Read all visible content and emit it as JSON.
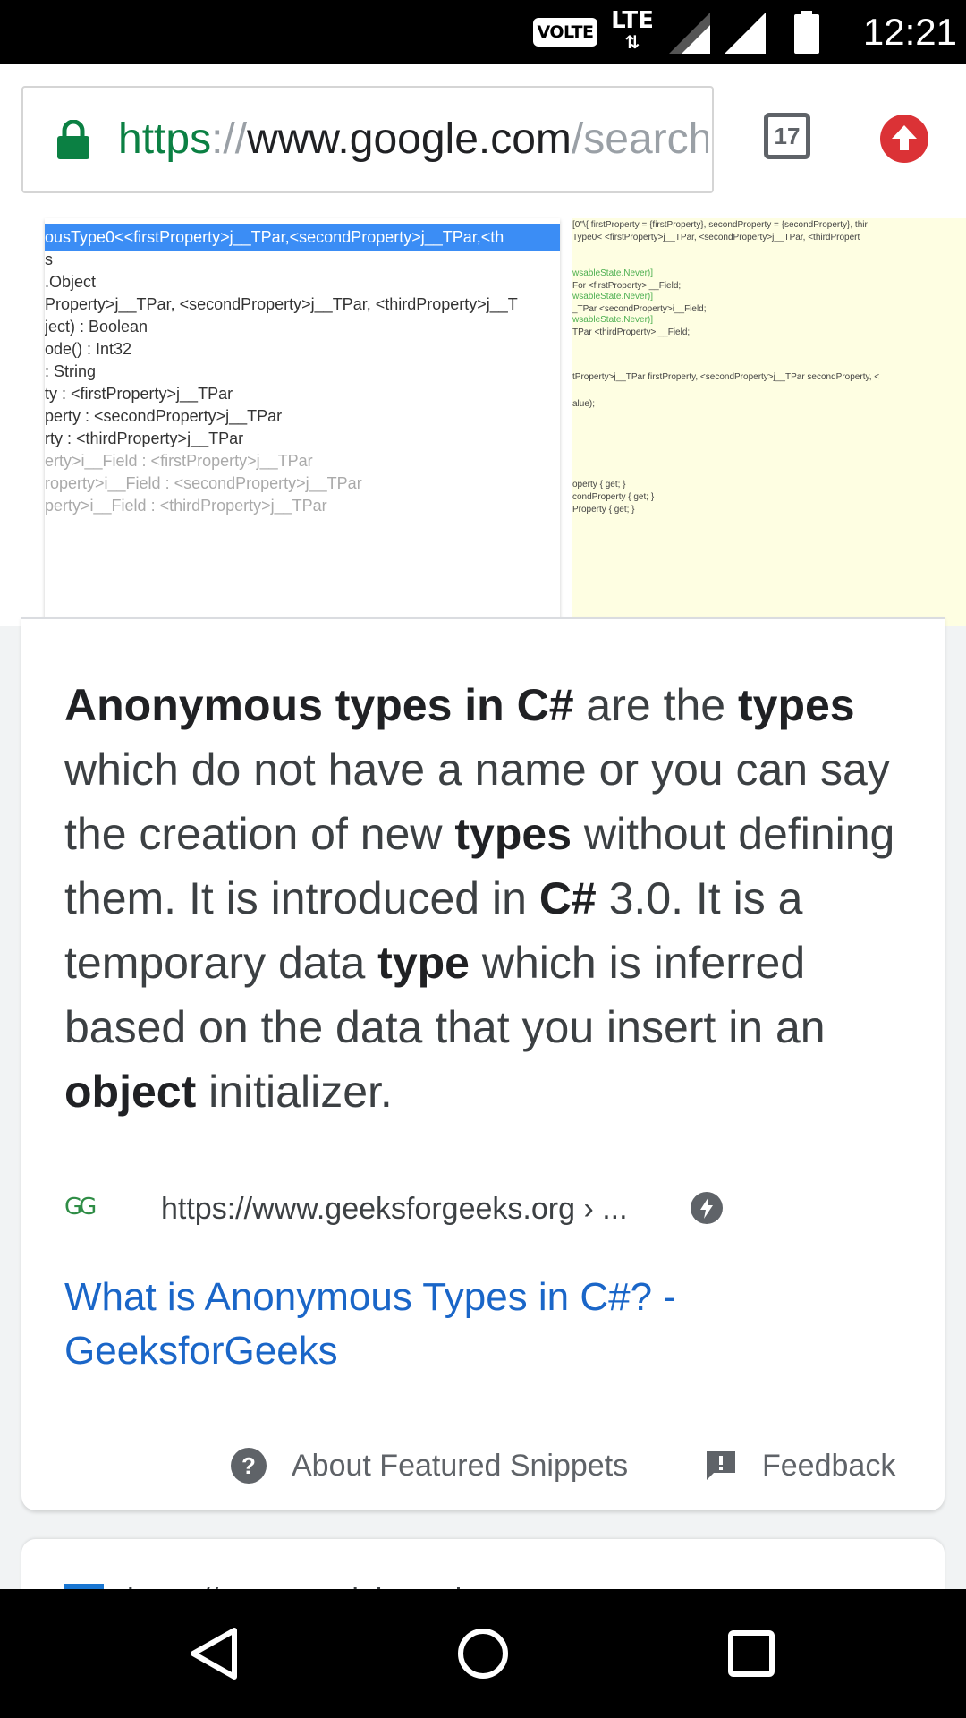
{
  "status_bar": {
    "volte": "VOLTE",
    "lte": "LTE",
    "time": "12:21"
  },
  "toolbar": {
    "url_scheme": "https",
    "url_sep": "://",
    "url_host": "www.google.com",
    "url_path": "/search?q=anonymous+types",
    "tab_count": "17"
  },
  "images": {
    "code_lines": [
      "ousType0<<firstProperty>j__TPar,<secondProperty>j__TPar,<th",
      "s",
      ".Object",
      "Property>j__TPar, <secondProperty>j__TPar, <thirdProperty>j__T",
      "ject) : Boolean",
      "ode() : Int32",
      ": String",
      "ty : <firstProperty>j__TPar",
      "perty : <secondProperty>j__TPar",
      "rty : <thirdProperty>j__TPar",
      "erty>i__Field : <firstProperty>j__TPar",
      "roperty>i__Field : <secondProperty>j__TPar",
      "perty>i__Field : <thirdProperty>j__TPar"
    ],
    "panel2_lines": [
      "[0\"\\{ firstProperty = {firstProperty}, secondProperty = {secondProperty}, thir",
      "Type0< <firstProperty>j__TPar, <secondProperty>j__TPar, <thirdPropert",
      "wsableState.Never)]",
      "For <firstProperty>i__Field;",
      "wsableState.Never)]",
      "_TPar <secondProperty>i__Field;",
      "wsableState.Never)]",
      "TPar <thirdProperty>i__Field;",
      "tProperty>j__TPar firstProperty, <secondProperty>j__TPar secondProperty, <",
      "alue);",
      "operty { get; }",
      "condProperty { get; }",
      "Property { get; }"
    ]
  },
  "card": {
    "snippet": [
      {
        "t": "Anonymous types in C#",
        "b": true
      },
      {
        "t": " are the ",
        "b": false
      },
      {
        "t": "types",
        "b": true
      },
      {
        "t": " which do not have a name or you can say the creation of new ",
        "b": false
      },
      {
        "t": "types",
        "b": true
      },
      {
        "t": " without defining them. It is introduced in ",
        "b": false
      },
      {
        "t": "C#",
        "b": true
      },
      {
        "t": " 3.0. It is a temporary data ",
        "b": false
      },
      {
        "t": "type",
        "b": true
      },
      {
        "t": " which is inferred based on the data that you insert in an ",
        "b": false
      },
      {
        "t": "object",
        "b": true
      },
      {
        "t": " initializer.",
        "b": false
      }
    ],
    "source_icon_text": "GG",
    "source_url": "https://www.geeksforgeeks.org › ...",
    "result_title": "What is Anonymous Types in C#? - GeeksforGeeks",
    "about_label": "About Featured Snippets",
    "feedback_label": "Feedback"
  },
  "next_card": {
    "partial_text": "https://www.tutorialsteacher.com"
  },
  "colors": {
    "link": "#1a66c8",
    "secure_green": "#0b8043",
    "update_red": "#db3236"
  }
}
